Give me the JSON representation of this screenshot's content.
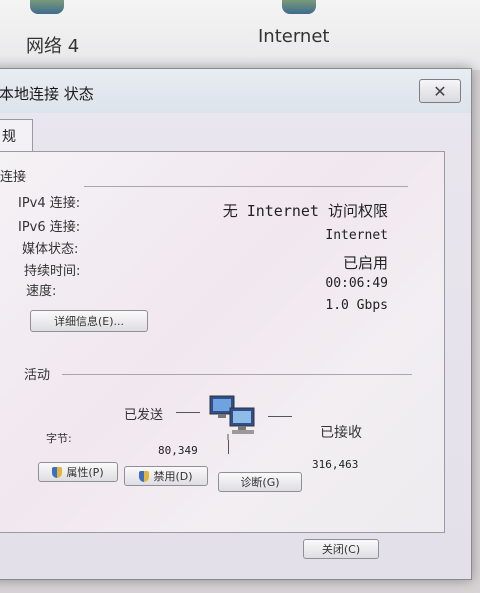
{
  "background": {
    "item_left": "网络 4",
    "item_right": "Internet"
  },
  "dialog": {
    "title": "本地连接 状态",
    "close_glyph": "✕",
    "tab_general": "规",
    "connection": {
      "group_label": "连接",
      "rows": [
        {
          "label": "IPv4 连接:",
          "value": "无 Internet 访问权限"
        },
        {
          "label": "IPv6 连接:",
          "value": "Internet"
        },
        {
          "label": "媒体状态:",
          "value": "已启用"
        },
        {
          "label": "持续时间:",
          "value": "00:06:49"
        },
        {
          "label": "速度:",
          "value": "1.0 Gbps"
        }
      ],
      "details_button": "详细信息(E)..."
    },
    "activity": {
      "group_label": "活动",
      "sent_label": "已发送",
      "received_label": "已接收",
      "bytes_label": "字节:",
      "bytes_sent": "80,349",
      "bytes_received": "316,463"
    },
    "buttons": {
      "properties": "属性(P)",
      "disable": "禁用(D)",
      "diagnose": "诊断(G)",
      "close": "关闭(C)"
    }
  }
}
